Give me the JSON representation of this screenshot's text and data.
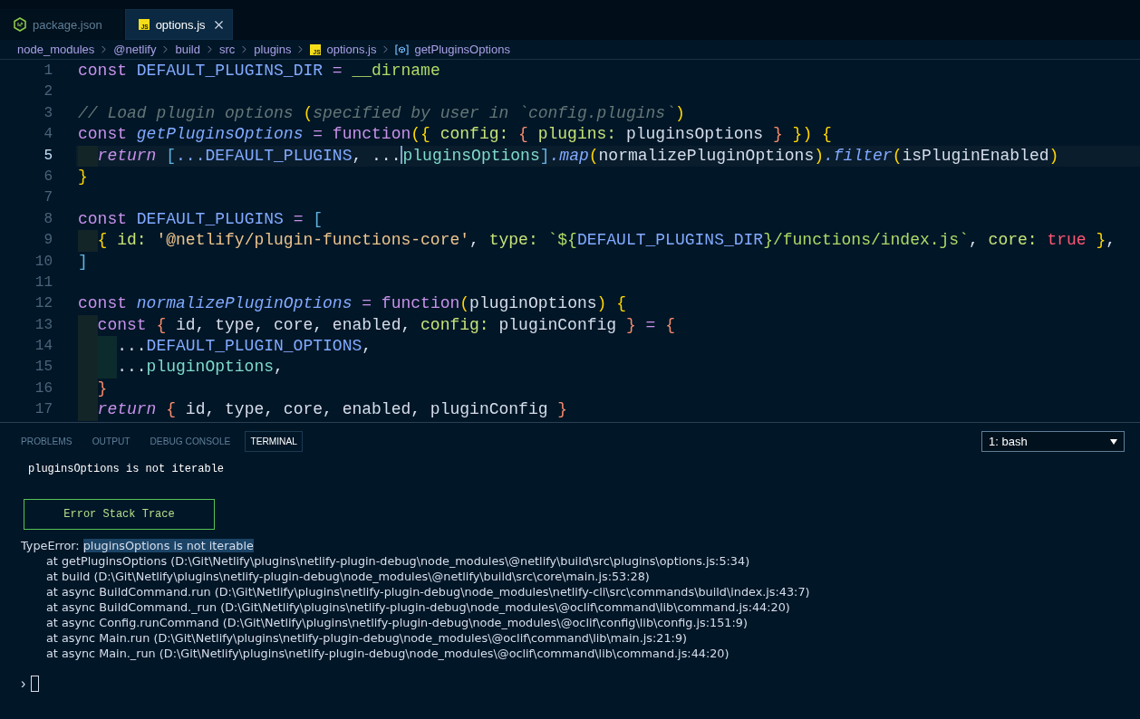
{
  "tabs": [
    {
      "label": "package.json",
      "kind": "node",
      "selected": false,
      "closable": false
    },
    {
      "label": "options.js",
      "kind": "js",
      "icon_text": "JS",
      "selected": true,
      "closable": true
    }
  ],
  "breadcrumbs": [
    {
      "label": "node_modules",
      "kind": "folder"
    },
    {
      "label": "@netlify",
      "kind": "folder"
    },
    {
      "label": "build",
      "kind": "folder"
    },
    {
      "label": "src",
      "kind": "folder"
    },
    {
      "label": "plugins",
      "kind": "folder"
    },
    {
      "label": "options.js",
      "kind": "file",
      "icon_text": "JS"
    },
    {
      "label": "getPluginsOptions",
      "kind": "symbol"
    }
  ],
  "editor": {
    "lines": [
      {
        "number": "1",
        "current": false,
        "tokens": [
          {
            "kind": "kw",
            "text": "const "
          },
          {
            "kind": "const",
            "text": "DEFAULT_PLUGINS_DIR "
          },
          {
            "kind": "kw",
            "text": "= "
          },
          {
            "kind": "global",
            "text": "__dirname"
          }
        ]
      },
      {
        "number": "2",
        "current": false
      },
      {
        "number": "3",
        "current": false,
        "tokens": [
          {
            "kind": "comment",
            "text": "// Load plugin options "
          },
          {
            "kind": "bracket1",
            "text": "("
          },
          {
            "kind": "comment",
            "text": "specified by user in `config.plugins`"
          },
          {
            "kind": "bracket1",
            "text": ")"
          }
        ]
      },
      {
        "number": "4",
        "current": false,
        "tokens": [
          {
            "kind": "kw",
            "text": "const "
          },
          {
            "kind": "fn",
            "text": "getPluginsOptions "
          },
          {
            "kind": "kw",
            "text": "= function"
          },
          {
            "kind": "bracket1",
            "text": "({ "
          },
          {
            "kind": "key",
            "text": "config: "
          },
          {
            "kind": "bracket2",
            "text": "{ "
          },
          {
            "kind": "key",
            "text": "plugins: "
          },
          {
            "kind": "plain",
            "text": "pluginsOptions "
          },
          {
            "kind": "bracket2",
            "text": "} "
          },
          {
            "kind": "bracket1",
            "text": "}) {"
          }
        ]
      },
      {
        "number": "5",
        "current": true,
        "tokens": [
          {
            "kind": "indent1"
          },
          {
            "kind": "kwi",
            "text": "return "
          },
          {
            "kind": "square",
            "text": "["
          },
          {
            "kind": "const",
            "text": "...DEFAULT_PLUGINS"
          },
          {
            "kind": "plain",
            "text": ", ..."
          },
          {
            "kind": "cursor"
          },
          {
            "kind": "teal",
            "text": "pluginsOptions"
          },
          {
            "kind": "square",
            "text": "]"
          },
          {
            "kind": "fn",
            "text": ".map"
          },
          {
            "kind": "bracket1",
            "text": "("
          },
          {
            "kind": "plain",
            "text": "normalizePluginOptions"
          },
          {
            "kind": "bracket1",
            "text": ")"
          },
          {
            "kind": "fn",
            "text": ".filter"
          },
          {
            "kind": "bracket1",
            "text": "("
          },
          {
            "kind": "plain",
            "text": "isPluginEnabled"
          },
          {
            "kind": "bracket1",
            "text": ")"
          }
        ]
      },
      {
        "number": "6",
        "current": false,
        "tokens": [
          {
            "kind": "bracket1",
            "text": "}"
          }
        ]
      },
      {
        "number": "7",
        "current": false
      },
      {
        "number": "8",
        "current": false,
        "tokens": [
          {
            "kind": "kw",
            "text": "const "
          },
          {
            "kind": "const",
            "text": "DEFAULT_PLUGINS "
          },
          {
            "kind": "kw",
            "text": "= "
          },
          {
            "kind": "square",
            "text": "["
          }
        ]
      },
      {
        "number": "9",
        "current": false,
        "tokens": [
          {
            "kind": "indent1"
          },
          {
            "kind": "bracket1",
            "text": "{ "
          },
          {
            "kind": "key",
            "text": "id: "
          },
          {
            "kind": "string",
            "text": "'@netlify/plugin-functions-core'"
          },
          {
            "kind": "plain",
            "text": ", "
          },
          {
            "kind": "key",
            "text": "type: "
          },
          {
            "kind": "template",
            "text": "`${"
          },
          {
            "kind": "const",
            "text": "DEFAULT_PLUGINS_DIR"
          },
          {
            "kind": "template",
            "text": "}/functions/index.js`"
          },
          {
            "kind": "plain",
            "text": ", "
          },
          {
            "kind": "key",
            "text": "core: "
          },
          {
            "kind": "bool",
            "text": "true "
          },
          {
            "kind": "bracket1",
            "text": "}"
          },
          {
            "kind": "plain",
            "text": ","
          }
        ]
      },
      {
        "number": "10",
        "current": false,
        "tokens": [
          {
            "kind": "square",
            "text": "]"
          }
        ]
      },
      {
        "number": "11",
        "current": false
      },
      {
        "number": "12",
        "current": false,
        "tokens": [
          {
            "kind": "kw",
            "text": "const "
          },
          {
            "kind": "fn",
            "text": "normalizePluginOptions "
          },
          {
            "kind": "kw",
            "text": "= function"
          },
          {
            "kind": "bracket1",
            "text": "("
          },
          {
            "kind": "plain",
            "text": "pluginOptions"
          },
          {
            "kind": "bracket1",
            "text": ") {"
          }
        ]
      },
      {
        "number": "13",
        "current": false,
        "tokens": [
          {
            "kind": "indent1"
          },
          {
            "kind": "kw",
            "text": "const "
          },
          {
            "kind": "bracket2",
            "text": "{ "
          },
          {
            "kind": "plain",
            "text": "id, type, core, enabled, "
          },
          {
            "kind": "key",
            "text": "config: "
          },
          {
            "kind": "plain",
            "text": "pluginConfig "
          },
          {
            "kind": "bracket2",
            "text": "} "
          },
          {
            "kind": "kw",
            "text": "= "
          },
          {
            "kind": "bracket2",
            "text": "{"
          }
        ]
      },
      {
        "number": "14",
        "current": false,
        "tokens": [
          {
            "kind": "indent1"
          },
          {
            "kind": "indent2"
          },
          {
            "kind": "plain",
            "text": "..."
          },
          {
            "kind": "const",
            "text": "DEFAULT_PLUGIN_OPTIONS"
          },
          {
            "kind": "plain",
            "text": ","
          }
        ]
      },
      {
        "number": "15",
        "current": false,
        "tokens": [
          {
            "kind": "indent1"
          },
          {
            "kind": "indent2"
          },
          {
            "kind": "plain",
            "text": "..."
          },
          {
            "kind": "teal",
            "text": "pluginOptions"
          },
          {
            "kind": "plain",
            "text": ","
          }
        ]
      },
      {
        "number": "16",
        "current": false,
        "tokens": [
          {
            "kind": "indent1"
          },
          {
            "kind": "bracket2",
            "text": "}"
          }
        ]
      },
      {
        "number": "17",
        "current": false,
        "tokens": [
          {
            "kind": "indent1"
          },
          {
            "kind": "kwi",
            "text": "return "
          },
          {
            "kind": "bracket2",
            "text": "{ "
          },
          {
            "kind": "plain",
            "text": "id, type, core, enabled, pluginConfig "
          },
          {
            "kind": "bracket2",
            "text": "}"
          }
        ]
      }
    ]
  },
  "panel": {
    "tabs": [
      {
        "label": "PROBLEMS",
        "selected": false
      },
      {
        "label": "OUTPUT",
        "selected": false
      },
      {
        "label": "DEBUG CONSOLE",
        "selected": false
      },
      {
        "label": "TERMINAL",
        "selected": true
      }
    ],
    "terminal_select": {
      "value": "1: bash"
    }
  },
  "terminal": {
    "message": "pluginsOptions is not iterable",
    "button": "Error Stack Trace",
    "error": {
      "segments": [
        {
          "text": "TypeError:",
          "selected": false
        },
        {
          "text": "pluginsOptions is not iterable",
          "selected": true
        }
      ]
    },
    "stack": [
      "at getPluginsOptions (D:\\Git\\Netlify\\plugins\\netlify-plugin-debug\\node_modules\\@netlify\\build\\src\\plugins\\options.js:5:34)",
      "at build (D:\\Git\\Netlify\\plugins\\netlify-plugin-debug\\node_modules\\@netlify\\build\\src\\core\\main.js:53:28)",
      "at async BuildCommand.run (D:\\Git\\Netlify\\plugins\\netlify-plugin-debug\\node_modules\\netlify-cli\\src\\commands\\build\\index.js:43:7)",
      "at async BuildCommand._run (D:\\Git\\Netlify\\plugins\\netlify-plugin-debug\\node_modules\\@oclif\\command\\lib\\command.js:44:20)",
      "at async Config.runCommand (D:\\Git\\Netlify\\plugins\\netlify-plugin-debug\\node_modules\\@oclif\\config\\lib\\config.js:151:9)",
      "at async Main.run (D:\\Git\\Netlify\\plugins\\netlify-plugin-debug\\node_modules\\@oclif\\command\\lib\\main.js:21:9)",
      "at async Main._run (D:\\Git\\Netlify\\plugins\\netlify-plugin-debug\\node_modules\\@oclif\\command\\lib\\command.js:44:20)"
    ],
    "prompt": "›"
  }
}
